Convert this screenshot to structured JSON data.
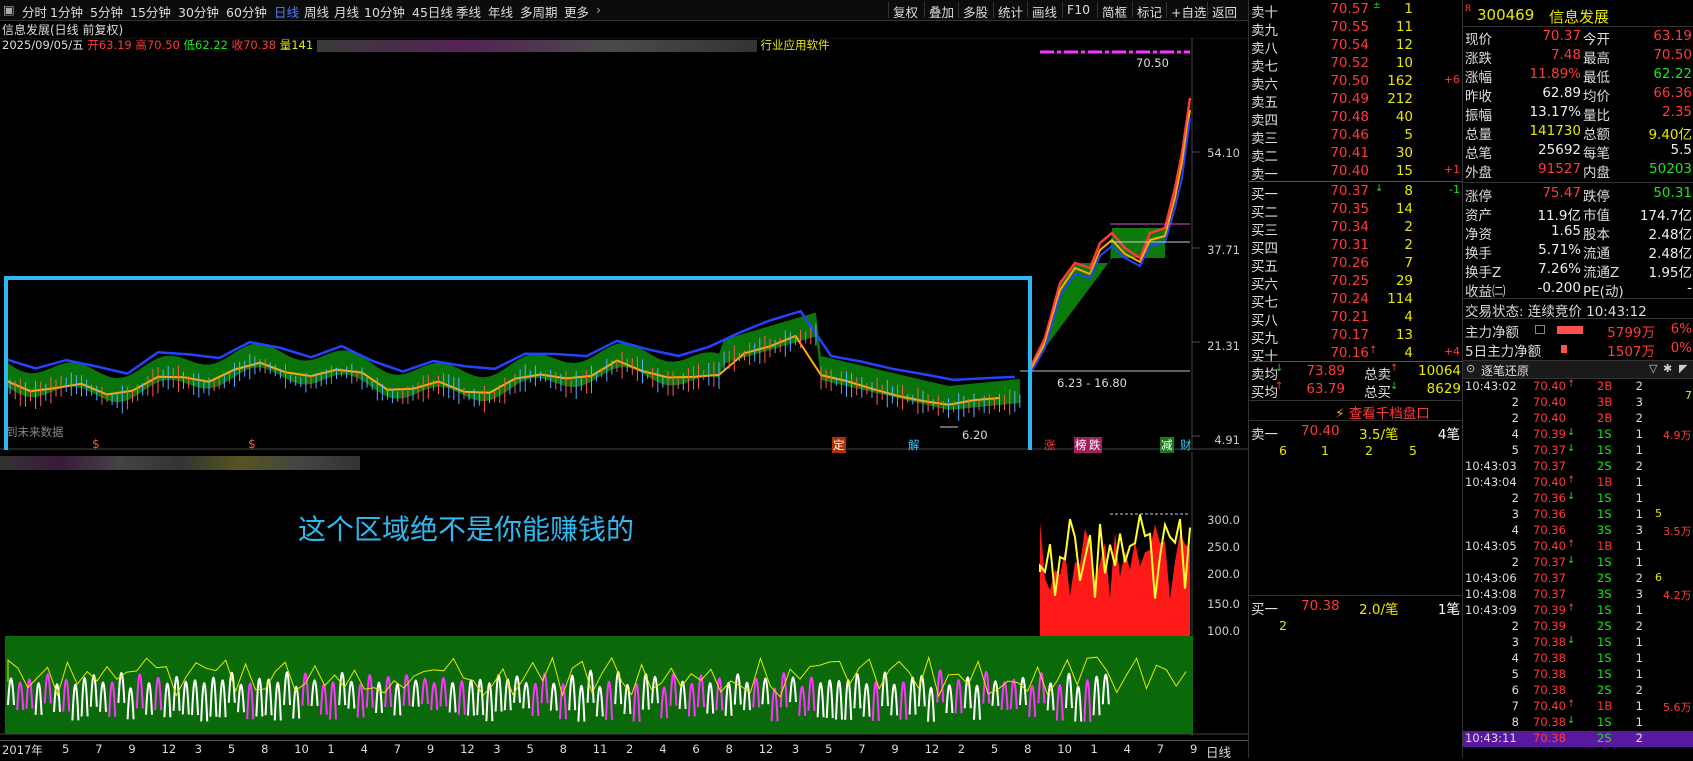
{
  "toolbar": {
    "items": [
      "分时",
      "1分钟",
      "5分钟",
      "15分钟",
      "30分钟",
      "60分钟",
      "日线",
      "周线",
      "月线",
      "10分钟",
      "45日线",
      "季线",
      "年线",
      "多周期",
      "更多"
    ],
    "active_index": 6,
    "right_items": [
      "复权",
      "叠加",
      "多股",
      "统计",
      "画线",
      "F10",
      "简框",
      "标记",
      "+自选",
      "返回"
    ]
  },
  "chart": {
    "title": "信息发展(日线 前复权)",
    "date_line": "2025/09/05/五",
    "open_label": "开63.19",
    "high_label": "高70.50",
    "low_label": "低62.22",
    "close_label": "收70.38",
    "vol_label": "量141",
    "extra_label": "行业应用软件",
    "price_axis": [
      "54.10",
      "37.71",
      "21.31",
      "4.91"
    ],
    "sub_axis": [
      "300.0",
      "250.0",
      "200.0",
      "150.0",
      "100.0"
    ],
    "high_marker": "70.50",
    "low_marker": "6.20",
    "range_marker": "6.23 - 16.80",
    "future_note": "到未来数据",
    "annotation": "这个区域绝不是你能赚钱的",
    "event_tags": [
      "定",
      "解",
      "涨",
      "榜",
      "跌",
      "减",
      "财"
    ],
    "x_axis_year": "2017年",
    "x_axis_ticks": [
      "5",
      "7",
      "9",
      "12",
      "3",
      "5",
      "8",
      "10",
      "1",
      "4",
      "7",
      "9",
      "12",
      "3",
      "5",
      "8",
      "11",
      "2",
      "4",
      "6",
      "8",
      "12",
      "3",
      "5",
      "7",
      "9",
      "12",
      "2",
      "5",
      "8",
      "10",
      "1",
      "4",
      "7",
      "9"
    ],
    "period_label": "日线"
  },
  "book": {
    "sells": [
      {
        "label": "卖十",
        "price": "70.57",
        "vol": "1",
        "chg": "",
        "up": true
      },
      {
        "label": "卖九",
        "price": "70.55",
        "vol": "11",
        "chg": ""
      },
      {
        "label": "卖八",
        "price": "70.54",
        "vol": "12",
        "chg": ""
      },
      {
        "label": "卖七",
        "price": "70.52",
        "vol": "10",
        "chg": ""
      },
      {
        "label": "卖六",
        "price": "70.50",
        "vol": "162",
        "chg": "+6"
      },
      {
        "label": "卖五",
        "price": "70.49",
        "vol": "212",
        "chg": ""
      },
      {
        "label": "卖四",
        "price": "70.48",
        "vol": "40",
        "chg": ""
      },
      {
        "label": "卖三",
        "price": "70.46",
        "vol": "5",
        "chg": ""
      },
      {
        "label": "卖二",
        "price": "70.41",
        "vol": "30",
        "chg": ""
      },
      {
        "label": "卖一",
        "price": "70.40",
        "vol": "15",
        "chg": "+1"
      }
    ],
    "buys": [
      {
        "label": "买一",
        "price": "70.37",
        "vol": "8",
        "chg": "-1"
      },
      {
        "label": "买二",
        "price": "70.35",
        "vol": "14",
        "chg": ""
      },
      {
        "label": "买三",
        "price": "70.34",
        "vol": "2",
        "chg": ""
      },
      {
        "label": "买四",
        "price": "70.31",
        "vol": "2",
        "chg": ""
      },
      {
        "label": "买五",
        "price": "70.26",
        "vol": "7",
        "chg": ""
      },
      {
        "label": "买六",
        "price": "70.25",
        "vol": "29",
        "chg": ""
      },
      {
        "label": "买七",
        "price": "70.24",
        "vol": "114",
        "chg": ""
      },
      {
        "label": "买八",
        "price": "70.21",
        "vol": "4",
        "chg": ""
      },
      {
        "label": "买九",
        "price": "70.17",
        "vol": "13",
        "chg": ""
      },
      {
        "label": "买十",
        "price": "70.16",
        "vol": "4",
        "chg": "+4"
      }
    ],
    "sell_avg_label": "卖均",
    "sell_avg": "73.89",
    "total_sell_label": "总卖",
    "total_sell": "10064",
    "buy_avg_label": "买均",
    "buy_avg": "63.79",
    "total_buy_label": "总买",
    "total_buy": "8629",
    "view_link": "查看千档盘口",
    "q1_label": "卖一",
    "q1_price": "70.40",
    "q1_per": "3.5/笔",
    "q1_count": "4笔",
    "q1_nums": [
      "6",
      "1",
      "2",
      "5"
    ],
    "q2_label": "买一",
    "q2_price": "70.38",
    "q2_per": "2.0/笔",
    "q2_count": "1笔",
    "q2_nums": [
      "2"
    ]
  },
  "quote": {
    "code": "300469",
    "name": "信息发展",
    "rows": [
      {
        "l1": "现价",
        "v1": "70.37",
        "c1": "red",
        "l2": "今开",
        "v2": "63.19",
        "c2": "red"
      },
      {
        "l1": "涨跌",
        "v1": "7.48",
        "c1": "red",
        "l2": "最高",
        "v2": "70.50",
        "c2": "red"
      },
      {
        "l1": "涨幅",
        "v1": "11.89%",
        "c1": "red",
        "l2": "最低",
        "v2": "62.22",
        "c2": "green"
      },
      {
        "l1": "昨收",
        "v1": "62.89",
        "c1": "white",
        "l2": "均价",
        "v2": "66.36",
        "c2": "red"
      },
      {
        "l1": "振幅",
        "v1": "13.17%",
        "c1": "white",
        "l2": "量比",
        "v2": "2.35",
        "c2": "red"
      },
      {
        "l1": "总量",
        "v1": "141730",
        "c1": "yellow",
        "l2": "总额",
        "v2": "9.40亿",
        "c2": "yellow"
      },
      {
        "l1": "总笔",
        "v1": "25692",
        "c1": "white",
        "l2": "每笔",
        "v2": "5.5",
        "c2": "white"
      },
      {
        "l1": "外盘",
        "v1": "91527",
        "c1": "red",
        "l2": "内盘",
        "v2": "50203",
        "c2": "green"
      },
      {
        "l1": "涨停",
        "v1": "75.47",
        "c1": "red",
        "l2": "跌停",
        "v2": "50.31",
        "c2": "green"
      },
      {
        "l1": "资产",
        "v1": "11.9亿",
        "c1": "white",
        "l2": "市值",
        "v2": "174.7亿",
        "c2": "white"
      },
      {
        "l1": "净资",
        "v1": "1.65",
        "c1": "white",
        "l2": "股本",
        "v2": "2.48亿",
        "c2": "white"
      },
      {
        "l1": "换手",
        "v1": "5.71%",
        "c1": "white",
        "l2": "流通",
        "v2": "2.48亿",
        "c2": "white"
      },
      {
        "l1": "换手Z",
        "v1": "7.26%",
        "c1": "white",
        "l2": "流通Z",
        "v2": "1.95亿",
        "c2": "white"
      },
      {
        "l1": "收益㈡",
        "v1": "-0.200",
        "c1": "white",
        "l2": "PE(动)",
        "v2": "-",
        "c2": "white"
      }
    ],
    "trade_status": "交易状态: 连续竞价 10:43:12",
    "main_flow_label": "主力净额",
    "main_flow": "5799万",
    "main_flow_pct": "6%",
    "flow5_label": "5日主力净额",
    "flow5": "1507万",
    "flow5_pct": "0%",
    "ticks_title": "逐笔还原",
    "ticks": [
      {
        "t": "10:43:02",
        "p": "70.40",
        "a": "up",
        "n": "2B",
        "v": "2"
      },
      {
        "t": "2",
        "p": "70.40",
        "a": "",
        "n": "3B",
        "v": "3"
      },
      {
        "t": "2",
        "p": "70.40",
        "a": "",
        "n": "2B",
        "v": "2"
      },
      {
        "t": "4",
        "p": "70.39",
        "a": "down",
        "n": "1S",
        "v": "1"
      },
      {
        "t": "5",
        "p": "70.37",
        "a": "down",
        "n": "1S",
        "v": "1"
      },
      {
        "t": "10:43:03",
        "p": "70.37",
        "a": "",
        "n": "2S",
        "v": "2"
      },
      {
        "t": "10:43:04",
        "p": "70.40",
        "a": "up",
        "n": "1B",
        "v": "1"
      },
      {
        "t": "2",
        "p": "70.36",
        "a": "down",
        "n": "1S",
        "v": "1"
      },
      {
        "t": "3",
        "p": "70.36",
        "a": "",
        "n": "1S",
        "v": "1"
      },
      {
        "t": "4",
        "p": "70.36",
        "a": "",
        "n": "3S",
        "v": "3"
      },
      {
        "t": "10:43:05",
        "p": "70.40",
        "a": "up",
        "n": "1B",
        "v": "1"
      },
      {
        "t": "2",
        "p": "70.37",
        "a": "down",
        "n": "1S",
        "v": "1"
      },
      {
        "t": "10:43:06",
        "p": "70.37",
        "a": "",
        "n": "2S",
        "v": "2"
      },
      {
        "t": "10:43:08",
        "p": "70.37",
        "a": "",
        "n": "3S",
        "v": "3"
      },
      {
        "t": "10:43:09",
        "p": "70.39",
        "a": "up",
        "n": "1S",
        "v": "1"
      },
      {
        "t": "2",
        "p": "70.39",
        "a": "",
        "n": "2S",
        "v": "2"
      },
      {
        "t": "3",
        "p": "70.38",
        "a": "down",
        "n": "1S",
        "v": "1"
      },
      {
        "t": "4",
        "p": "70.38",
        "a": "",
        "n": "1S",
        "v": "1"
      },
      {
        "t": "5",
        "p": "70.38",
        "a": "",
        "n": "1S",
        "v": "1"
      },
      {
        "t": "6",
        "p": "70.38",
        "a": "",
        "n": "2S",
        "v": "2"
      },
      {
        "t": "7",
        "p": "70.40",
        "a": "up",
        "n": "1B",
        "v": "1"
      },
      {
        "t": "8",
        "p": "70.38",
        "a": "down",
        "n": "1S",
        "v": "1"
      },
      {
        "t": "10:43:11",
        "p": "70.38",
        "a": "",
        "n": "2S",
        "v": "2"
      }
    ],
    "tick_side_vals": [
      {
        "row": 3,
        "text": "4.9万"
      },
      {
        "row": 9,
        "text": "3.5万"
      },
      {
        "row": 13,
        "text": "4.2万"
      },
      {
        "row": 20,
        "text": "5.6万"
      }
    ],
    "tick_side_small": [
      {
        "row": 8,
        "text": "5"
      },
      {
        "row": 12,
        "text": "6"
      },
      {
        "row": 0,
        "text": "7"
      }
    ]
  },
  "colors": {
    "up": "#ff3a3a",
    "down": "#18e818",
    "vol": "#e8e800",
    "accent": "#2fb8f0",
    "active": "#4d7fff"
  }
}
